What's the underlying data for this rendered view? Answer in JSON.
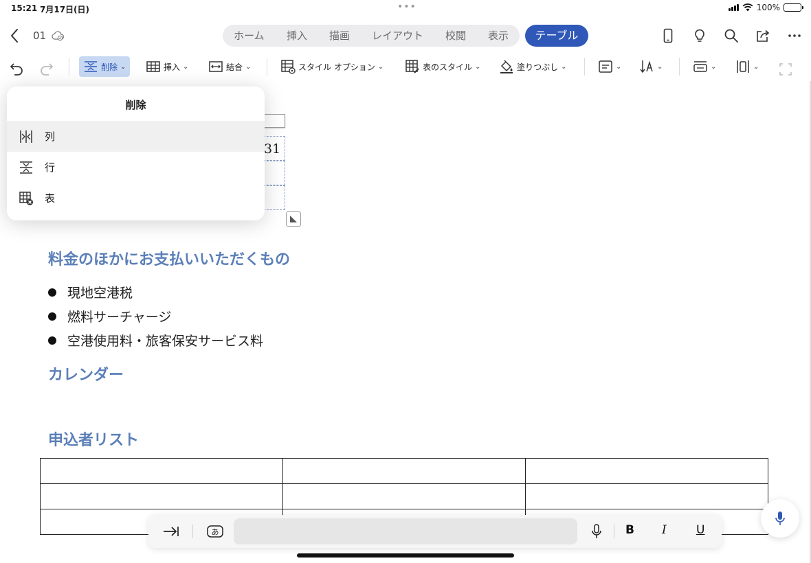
{
  "status_bar": {
    "time": "15:21",
    "date": "7月17日(日)",
    "battery": "100%"
  },
  "document_title": "01",
  "tabs": [
    {
      "label": "ホーム"
    },
    {
      "label": "挿入"
    },
    {
      "label": "描画"
    },
    {
      "label": "レイアウト"
    },
    {
      "label": "校閲"
    },
    {
      "label": "表示"
    }
  ],
  "active_tab": "テーブル",
  "toolbar": {
    "delete": "削除",
    "insert": "挿入",
    "merge": "結合",
    "style_options": "スタイル オプション",
    "table_styles": "表のスタイル",
    "shading": "塗りつぶし"
  },
  "dropdown": {
    "title": "削除",
    "items": [
      {
        "label": "列"
      },
      {
        "label": "行"
      },
      {
        "label": "表"
      }
    ]
  },
  "document": {
    "table_fragment_text": "31",
    "sections": [
      {
        "heading": "料金のほかにお支払いいただくもの"
      },
      {
        "heading": "カレンダー"
      },
      {
        "heading": "申込者リスト"
      }
    ],
    "bullets": [
      "現地空港税",
      "燃料サーチャージ",
      "空港使用料・旅客保安サービス料"
    ]
  },
  "bottom_bar": {
    "input_value": "",
    "bold": "B",
    "italic": "I",
    "underline": "U"
  },
  "colors": {
    "accent": "#2f58b8",
    "heading": "#5b7fb8",
    "selection": "#c7d8f3"
  }
}
